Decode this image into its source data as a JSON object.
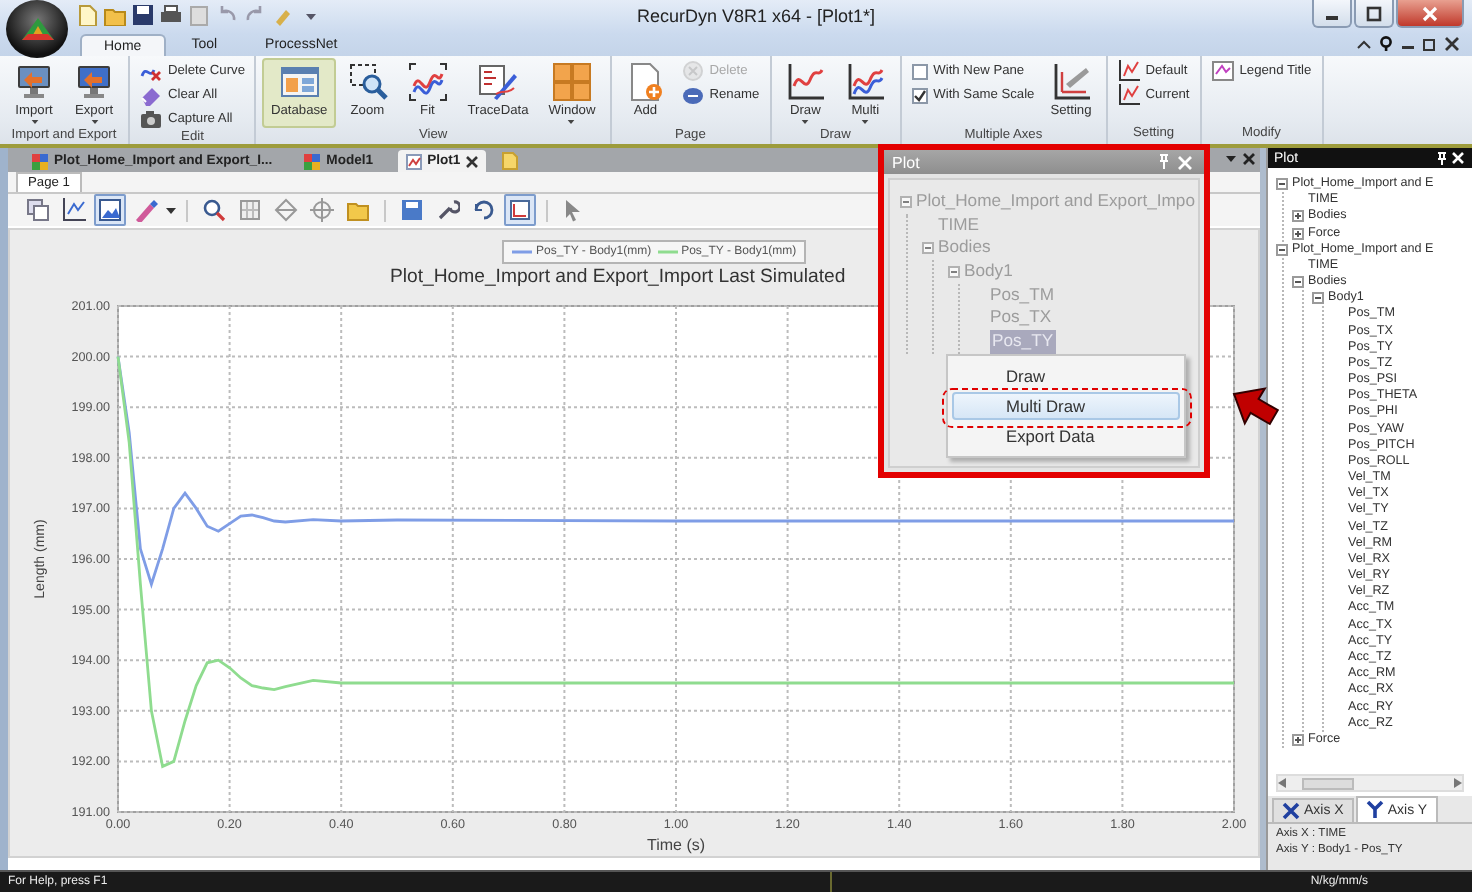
{
  "window": {
    "title": "RecurDyn V8R1 x64 - [Plot1*]"
  },
  "ribbon_tabs": [
    {
      "label": "Home",
      "selected": true
    },
    {
      "label": "Tool",
      "selected": false
    },
    {
      "label": "ProcessNet",
      "selected": false
    }
  ],
  "ribbon_groups": [
    {
      "label": "Import and Export",
      "items": [
        {
          "kind": "large",
          "label": "Import",
          "dropdown": true
        },
        {
          "kind": "large",
          "label": "Export",
          "dropdown": true
        }
      ]
    },
    {
      "label": "Edit",
      "items": [
        {
          "kind": "small",
          "label": "Delete Curve",
          "disabled": false
        },
        {
          "kind": "small",
          "label": "Clear All",
          "disabled": false
        },
        {
          "kind": "small",
          "label": "Capture All",
          "disabled": false
        }
      ]
    },
    {
      "label": "View",
      "items": [
        {
          "kind": "large",
          "label": "Database",
          "dropdown": false,
          "active": true
        },
        {
          "kind": "large",
          "label": "Zoom",
          "dropdown": false,
          "active": false
        },
        {
          "kind": "large",
          "label": "Fit",
          "dropdown": false,
          "active": false
        },
        {
          "kind": "large",
          "label": "TraceData",
          "dropdown": false,
          "active": false
        },
        {
          "kind": "large",
          "label": "Window",
          "dropdown": true,
          "active": false
        }
      ]
    },
    {
      "label": "Page",
      "items": [
        {
          "kind": "large",
          "label": "Add",
          "dropdown": false
        },
        {
          "kind": "small",
          "label": "Delete",
          "disabled": true
        },
        {
          "kind": "small",
          "label": "Rename",
          "disabled": false
        }
      ]
    },
    {
      "label": "Draw",
      "items": [
        {
          "kind": "large",
          "label": "Draw",
          "dropdown": true
        },
        {
          "kind": "large",
          "label": "Multi",
          "dropdown": true
        }
      ]
    },
    {
      "label": "Multiple Axes",
      "items": [
        {
          "kind": "check",
          "label": "With New Pane",
          "checked": false
        },
        {
          "kind": "check",
          "label": "With Same Scale",
          "checked": true
        },
        {
          "kind": "large",
          "label": "Setting",
          "dropdown": false
        }
      ]
    },
    {
      "label": "Setting",
      "items": [
        {
          "kind": "small",
          "label": "Default",
          "disabled": false
        },
        {
          "kind": "small",
          "label": "Current",
          "disabled": false
        }
      ]
    },
    {
      "label": "Modify",
      "items": [
        {
          "kind": "small",
          "label": "Legend Title",
          "disabled": false
        }
      ]
    }
  ],
  "doc_tabs": [
    {
      "label": "Plot_Home_Import and Export_I...",
      "selected": false
    },
    {
      "label": "Model1",
      "selected": false
    },
    {
      "label": "Plot1",
      "selected": true
    }
  ],
  "page_tabs": [
    {
      "label": "Page 1",
      "selected": true
    }
  ],
  "toolbar": [
    {
      "pressed": false
    },
    {
      "pressed": false
    },
    {
      "pressed": true
    },
    {
      "pressed": false
    },
    {
      "pressed": false
    },
    {
      "pressed": false
    },
    {
      "pressed": false
    },
    {
      "pressed": false
    },
    {
      "pressed": false
    },
    {
      "pressed": false
    },
    {
      "pressed": false
    },
    {
      "pressed": false
    },
    {
      "pressed": true
    },
    {
      "pressed": false
    }
  ],
  "plot": {
    "chart_data": {
      "type": "line",
      "title": "Plot_Home_Import and Export_Import Last Simulated",
      "xlabel": "Time (s)",
      "ylabel": "Length (mm)",
      "x": [
        0,
        0.02,
        0.04,
        0.06,
        0.08,
        0.1,
        0.12,
        0.14,
        0.16,
        0.18,
        0.2,
        0.22,
        0.24,
        0.26,
        0.28,
        0.3,
        0.35,
        0.4,
        0.5,
        1.0,
        1.5,
        2.0
      ],
      "series": [
        {
          "name": "Pos_TY - Body1(mm)",
          "color": "#7f9de6",
          "values": [
            200,
            198.5,
            196.2,
            195.5,
            196.2,
            197.0,
            197.3,
            197.0,
            196.65,
            196.55,
            196.7,
            196.85,
            196.87,
            196.82,
            196.75,
            196.73,
            196.78,
            196.75,
            196.77,
            196.75,
            196.75,
            196.75
          ]
        },
        {
          "name": "Pos_TY - Body1(mm)",
          "color": "#8fdc8f",
          "values": [
            200,
            198.3,
            195.5,
            193.0,
            191.9,
            192.0,
            192.8,
            193.5,
            193.95,
            194.0,
            193.85,
            193.65,
            193.5,
            193.45,
            193.42,
            193.48,
            193.6,
            193.55,
            193.55,
            193.55,
            193.55,
            193.55
          ]
        }
      ],
      "xlim": [
        0,
        2
      ],
      "ylim": [
        191,
        201
      ],
      "grid": true,
      "xticks": [
        {
          "value": 0,
          "label": "0.00"
        },
        {
          "value": 0.2,
          "label": "0.20"
        },
        {
          "value": 0.4,
          "label": "0.40"
        },
        {
          "value": 0.6,
          "label": "0.60"
        },
        {
          "value": 0.8,
          "label": "0.80"
        },
        {
          "value": 1.0,
          "label": "1.00"
        },
        {
          "value": 1.2,
          "label": "1.20"
        },
        {
          "value": 1.4,
          "label": "1.40"
        },
        {
          "value": 1.6,
          "label": "1.60"
        },
        {
          "value": 1.8,
          "label": "1.80"
        },
        {
          "value": 2.0,
          "label": "2.00"
        }
      ],
      "yticks": [
        {
          "value": 191,
          "label": "191.00"
        },
        {
          "value": 192,
          "label": "192.00"
        },
        {
          "value": 193,
          "label": "193.00"
        },
        {
          "value": 194,
          "label": "194.00"
        },
        {
          "value": 195,
          "label": "195.00"
        },
        {
          "value": 196,
          "label": "196.00"
        },
        {
          "value": 197,
          "label": "197.00"
        },
        {
          "value": 198,
          "label": "198.00"
        },
        {
          "value": 199,
          "label": "199.00"
        },
        {
          "value": 200,
          "label": "200.00"
        },
        {
          "value": 201,
          "label": "201.00"
        }
      ]
    }
  },
  "side_panel": {
    "title": "Plot",
    "tree": [
      {
        "label": "Plot_Home_Import and E",
        "expanded": true,
        "children": [
          {
            "label": "TIME"
          },
          {
            "label": "Bodies",
            "expanded": false
          },
          {
            "label": "Force",
            "expanded": false
          }
        ]
      },
      {
        "label": "Plot_Home_Import and E",
        "expanded": true,
        "children": [
          {
            "label": "TIME"
          },
          {
            "label": "Bodies",
            "expanded": true,
            "children": [
              {
                "label": "Body1",
                "expanded": true,
                "children": [
                  {
                    "label": "Pos_TM"
                  },
                  {
                    "label": "Pos_TX"
                  },
                  {
                    "label": "Pos_TY"
                  },
                  {
                    "label": "Pos_TZ"
                  },
                  {
                    "label": "Pos_PSI"
                  },
                  {
                    "label": "Pos_THETA"
                  },
                  {
                    "label": "Pos_PHI"
                  },
                  {
                    "label": "Pos_YAW"
                  },
                  {
                    "label": "Pos_PITCH"
                  },
                  {
                    "label": "Pos_ROLL"
                  },
                  {
                    "label": "Vel_TM"
                  },
                  {
                    "label": "Vel_TX"
                  },
                  {
                    "label": "Vel_TY"
                  },
                  {
                    "label": "Vel_TZ"
                  },
                  {
                    "label": "Vel_RM"
                  },
                  {
                    "label": "Vel_RX"
                  },
                  {
                    "label": "Vel_RY"
                  },
                  {
                    "label": "Vel_RZ"
                  },
                  {
                    "label": "Acc_TM"
                  },
                  {
                    "label": "Acc_TX"
                  },
                  {
                    "label": "Acc_TY"
                  },
                  {
                    "label": "Acc_TZ"
                  },
                  {
                    "label": "Acc_RM"
                  },
                  {
                    "label": "Acc_RX"
                  },
                  {
                    "label": "Acc_RY"
                  },
                  {
                    "label": "Acc_RZ"
                  }
                ]
              }
            ]
          },
          {
            "label": "Force",
            "expanded": false
          }
        ]
      }
    ],
    "axis_tabs": [
      {
        "label": "Axis X",
        "selected": false
      },
      {
        "label": "Axis Y",
        "selected": true
      }
    ],
    "axis_info": [
      "Axis X : TIME",
      "Axis Y : Body1 - Pos_TY"
    ]
  },
  "popup": {
    "title": "Plot",
    "tree": [
      {
        "label": "Plot_Home_Import and Export_Impo",
        "expanded": true,
        "children": [
          {
            "label": "TIME"
          },
          {
            "label": "Bodies",
            "expanded": true,
            "children": [
              {
                "label": "Body1",
                "expanded": true,
                "children": [
                  {
                    "label": "Pos_TM",
                    "selected": false
                  },
                  {
                    "label": "Pos_TX",
                    "selected": false
                  },
                  {
                    "label": "Pos_TY",
                    "selected": true
                  }
                ]
              }
            ]
          }
        ]
      }
    ],
    "context_menu": [
      {
        "label": "Draw",
        "hovered": false
      },
      {
        "label": "Multi Draw",
        "hovered": true
      },
      {
        "label": "Export Data",
        "hovered": false
      }
    ]
  },
  "status_bar": {
    "left": "For Help, press F1",
    "right": "N/kg/mm/s"
  }
}
